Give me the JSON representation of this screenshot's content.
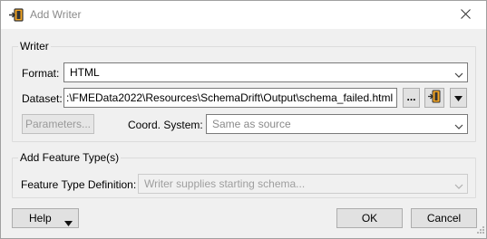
{
  "window": {
    "title": "Add Writer"
  },
  "writer_group": {
    "title": "Writer",
    "format_label": "Format:",
    "format_value": "HTML",
    "dataset_label": "Dataset:",
    "dataset_value": ":\\FMEData2022\\Resources\\SchemaDrift\\Output\\schema_failed.html",
    "browse_button": "...",
    "parameters_button": "Parameters...",
    "coord_label": "Coord. System:",
    "coord_placeholder": "Same as source"
  },
  "feature_group": {
    "title": "Add Feature Type(s)",
    "definition_label": "Feature Type Definition:",
    "definition_value": "Writer supplies starting schema..."
  },
  "footer": {
    "help_button": "Help",
    "ok_button": "OK",
    "cancel_button": "Cancel"
  },
  "icons": {
    "title": "add-writer-icon",
    "close": "close-icon",
    "chevron": "chevron-down-icon",
    "dataset_picker": "file-picker-icon",
    "dataset_menu": "triangle-down-icon",
    "help_menu": "triangle-down-icon"
  },
  "colors": {
    "background": "#f0f0f0",
    "titlebar": "#ffffff",
    "disabled_text": "#9e9e9e",
    "icon_accent": "#f5a623"
  }
}
